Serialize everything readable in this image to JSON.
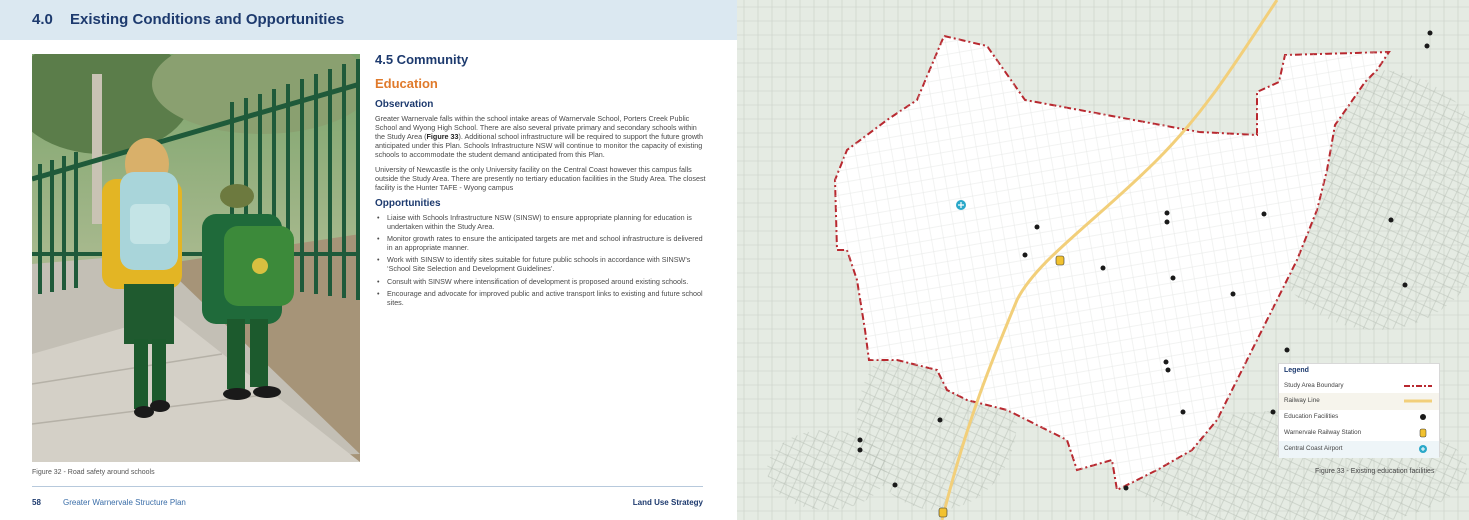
{
  "header": {
    "section_number": "4.0",
    "section_title": "Existing Conditions and Opportunities"
  },
  "content": {
    "heading": "4.5 Community",
    "subheading": "Education",
    "observation_heading": "Observation",
    "observation_p1_a": "Greater Warnervale falls within the school intake areas of Warnervale School, Porters Creek Public School and Wyong High School. There are also several private primary and secondary schools within the Study Area (",
    "observation_p1_fig": "Figure 33",
    "observation_p1_b": "). Additional school infrastructure will be required to support the future growth anticipated under this Plan. Schools Infrastructure NSW will continue to monitor the capacity of existing schools to accommodate the student demand anticipated from this Plan.",
    "observation_p2": "University of Newcastle is the only University facility on the Central Coast however this campus falls outside the Study Area. There are presently no tertiary education facilities in the Study Area. The closest facility is the Hunter TAFE - Wyong campus",
    "opportunities_heading": "Opportunities",
    "opportunities": [
      "Liaise with Schools Infrastructure NSW (SINSW) to ensure appropriate planning for education is undertaken within the Study Area.",
      "Monitor growth rates to ensure the anticipated targets are met and school infrastructure is delivered in an appropriate manner.",
      "Work with SINSW to identify sites suitable for future public schools in accordance with SINSW’s ‘School Site Selection and Development Guidelines’.",
      "Consult with SINSW where intensification of development is proposed around existing schools.",
      "Encourage and advocate for improved public and active transport links to existing and future school sites."
    ]
  },
  "photo_caption": "Figure 32 - Road safety around schools",
  "footer": {
    "page_number": "58",
    "document_title": "Greater Warnervale Structure Plan",
    "chapter": "Land Use Strategy"
  },
  "map": {
    "legend_title": "Legend",
    "legend_items": [
      {
        "label": "Study Area Boundary",
        "symbol": "dash-line",
        "color": "#b8282f"
      },
      {
        "label": "Railway Line",
        "symbol": "rail-line",
        "color": "#f2cf7a"
      },
      {
        "label": "Education Facilities",
        "symbol": "school-icon",
        "color": "#1a1a1a"
      },
      {
        "label": "Warnervale Railway Station",
        "symbol": "train-icon",
        "color": "#f2c230"
      },
      {
        "label": "Central Coast Airport",
        "symbol": "airport-icon",
        "color": "#2aa8c9"
      }
    ],
    "caption": "Figure 33 - Existing education facilities"
  },
  "colors": {
    "navy": "#1d3a6e",
    "orange": "#e07a2b",
    "header_band": "#dbe8f1",
    "boundary": "#b8282f"
  }
}
